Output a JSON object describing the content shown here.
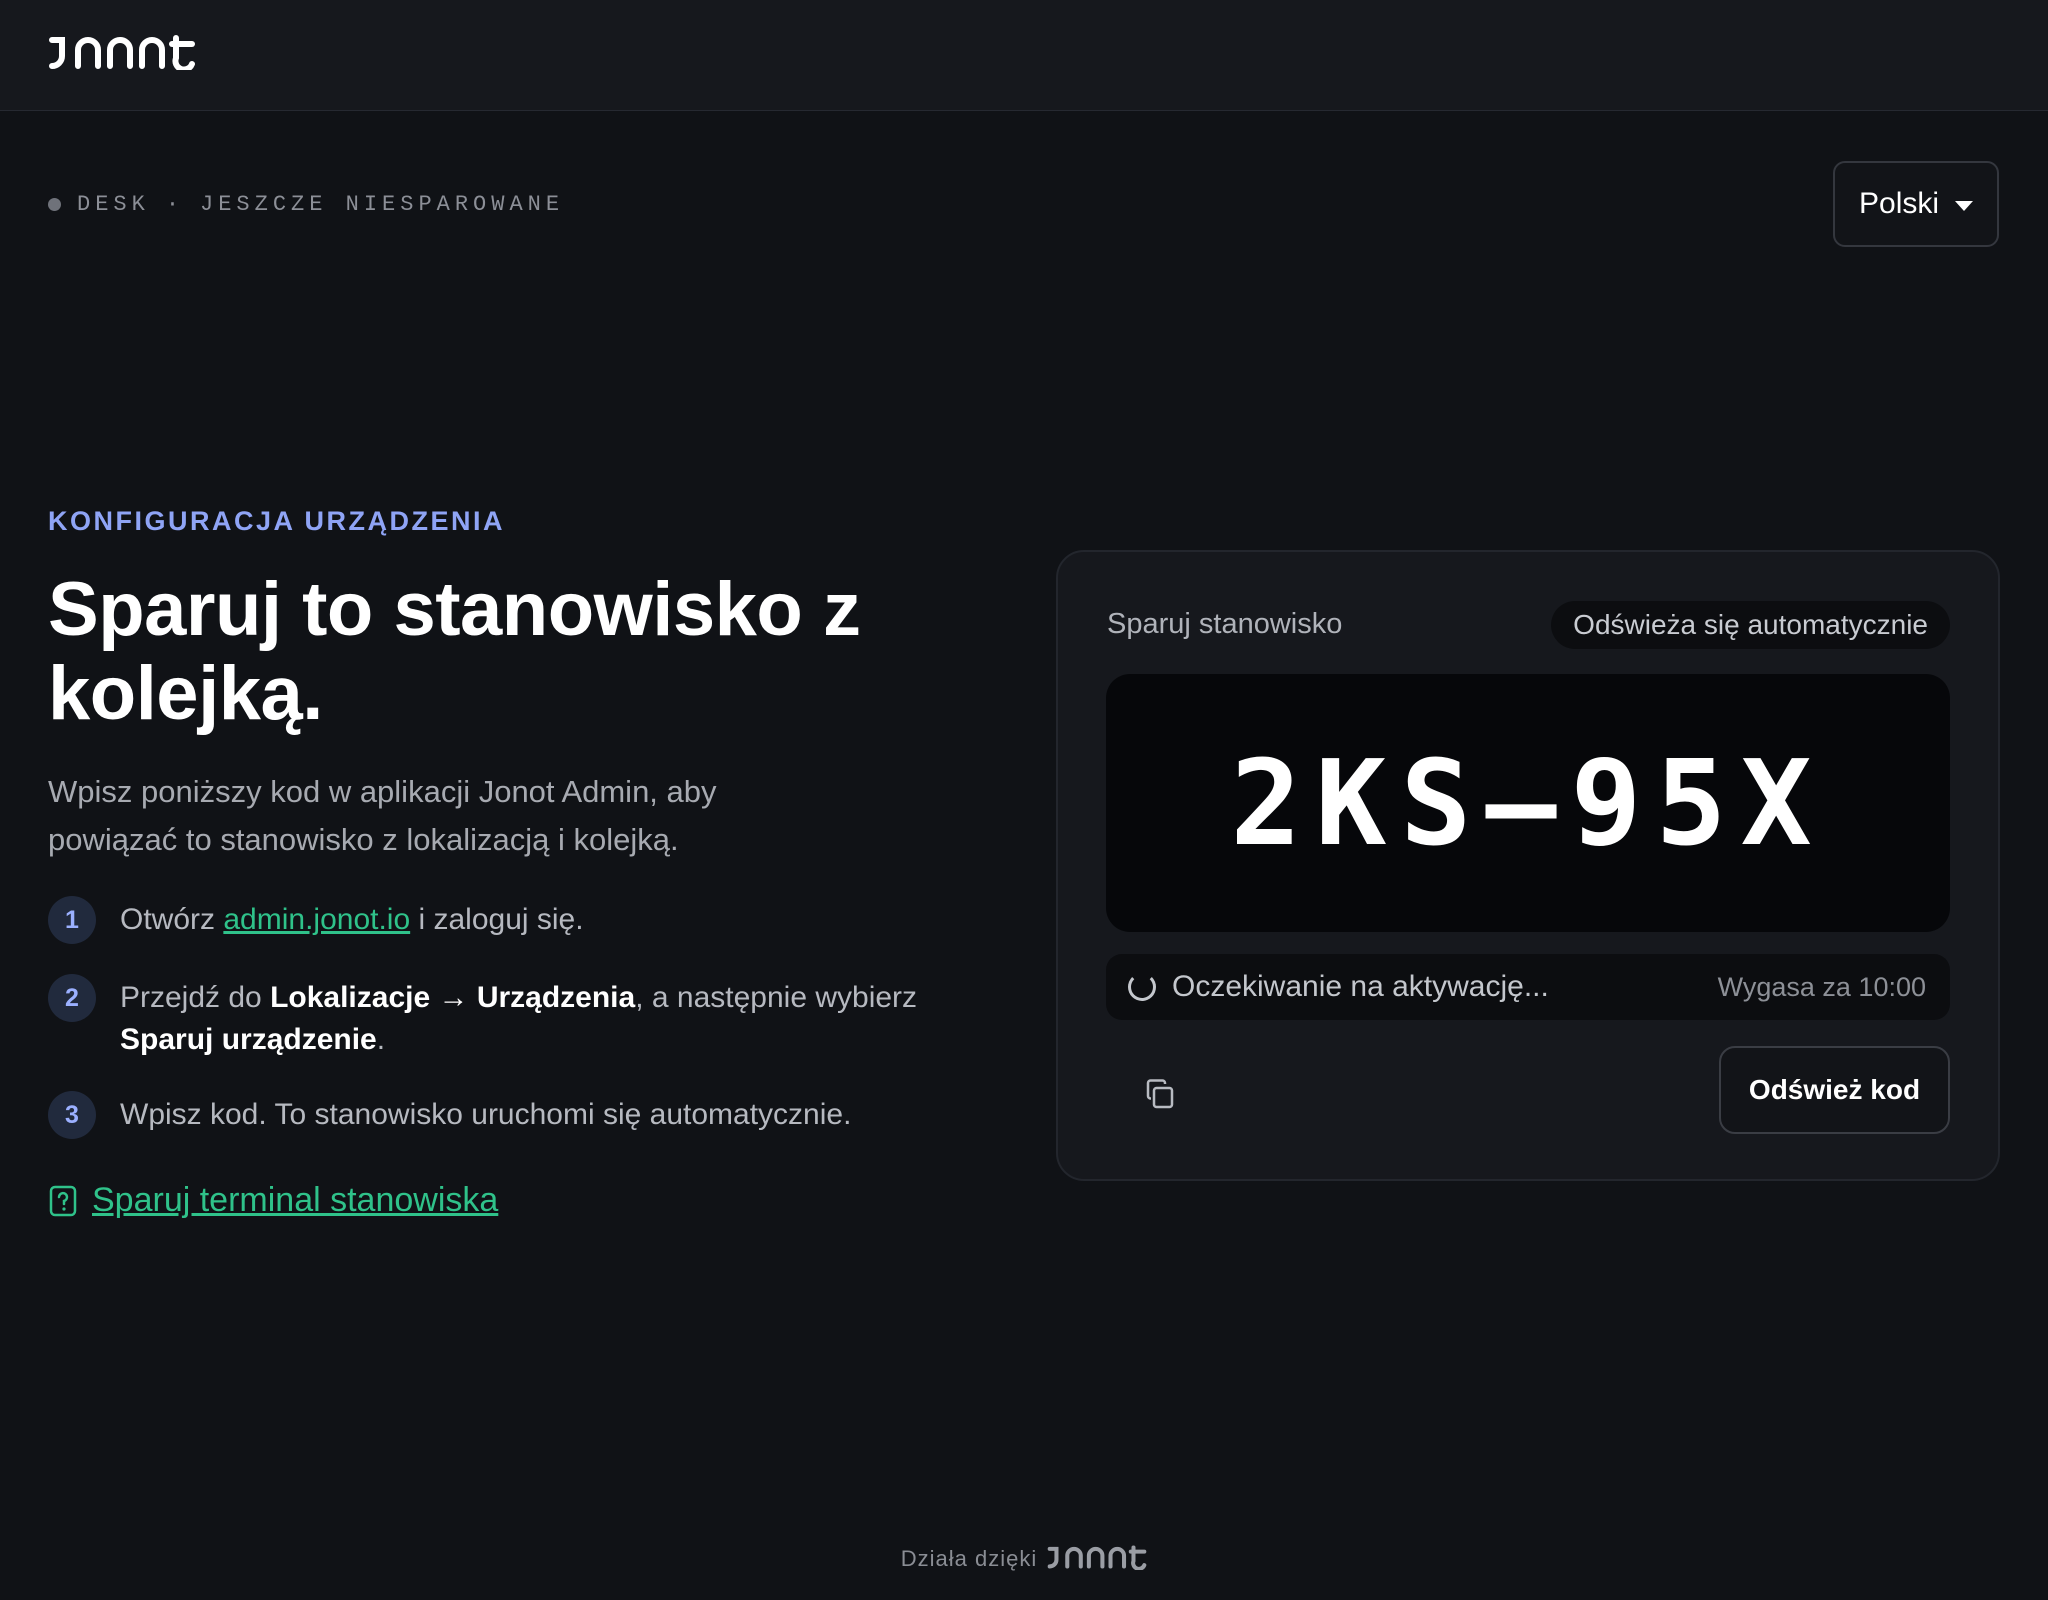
{
  "header": {
    "logo_text": "JONOT",
    "logo_icon": "jonot-logo"
  },
  "status": {
    "device_type": "DESK",
    "separator": "·",
    "pair_state": "JESZCZE NIESPAROWANE"
  },
  "language": {
    "selected": "Polski"
  },
  "intro": {
    "eyebrow": "KONFIGURACJA URZĄDZENIA",
    "headline": "Sparuj to stanowisko z kolejką.",
    "lead": "Wpisz poniższy kod w aplikacji Jonot Admin, aby powiązać to stanowisko z lokalizacją i kolejką."
  },
  "steps": [
    {
      "num": "1",
      "pre": "Otwórz ",
      "link": "admin.jonot.io",
      "post": " i zaloguj się."
    },
    {
      "num": "2",
      "pre": "Przejdź do ",
      "bold1": "Lokalizacje → Urządzenia",
      "mid": ", a następnie wybierz ",
      "bold2": "Sparuj urządzenie",
      "post": "."
    },
    {
      "num": "3",
      "text": "Wpisz kod. To stanowisko uruchomi się automatycznie."
    }
  ],
  "help_link": {
    "label": "Sparuj terminal stanowiska",
    "icon": "help-document-icon"
  },
  "pair_card": {
    "title": "Sparuj stanowisko",
    "auto_refresh": "Odświeża się automatycznie",
    "code": "2KS–95X",
    "waiting": "Oczekiwanie na aktywację...",
    "expires": "Wygasa za 10:00",
    "copy_icon": "copy-icon",
    "refresh_label": "Odśwież kod"
  },
  "footer": {
    "powered_by": "Działa dzięki",
    "logo_text": "JONOT"
  },
  "colors": {
    "background": "#101216",
    "accent_green": "#2fc28a",
    "accent_blue": "#8fa4f5"
  }
}
